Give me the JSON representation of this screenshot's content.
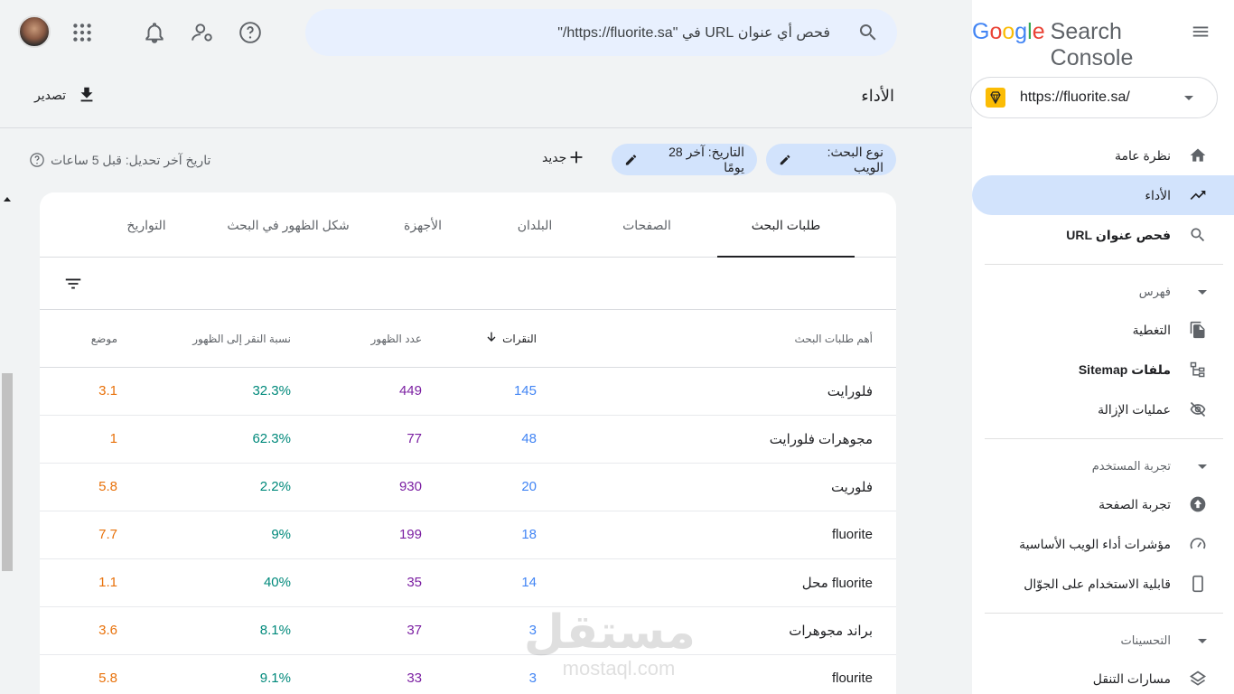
{
  "app": {
    "logo_google": [
      "G",
      "o",
      "o",
      "g",
      "l",
      "e"
    ],
    "logo_rest": "Search Console",
    "property_url": "https://fluorite.sa/"
  },
  "search": {
    "placeholder": "فحص أي عنوان URL في \"https://fluorite.sa/\""
  },
  "sidebar": {
    "items": [
      {
        "label": "نظرة عامة",
        "icon": "home-icon"
      },
      {
        "label": "الأداء",
        "icon": "trending-up-icon",
        "active": true
      },
      {
        "label": "فحص عنوان URL",
        "icon": "search-icon"
      }
    ],
    "sections": [
      {
        "label": "فهرس",
        "items": [
          "التغطية",
          "ملفات Sitemap",
          "عمليات الإزالة"
        ]
      },
      {
        "label": "تجربة المستخدم",
        "items": [
          "تجربة الصفحة",
          "مؤشرات أداء الويب الأساسية",
          "قابلية الاستخدام على الجوّال"
        ]
      },
      {
        "label": "التحسينات",
        "items": [
          "مسارات التنقل"
        ]
      }
    ]
  },
  "header": {
    "title": "الأداء",
    "export_label": "تصدير"
  },
  "filters": {
    "search_type": "نوع البحث: الويب",
    "date": "التاريخ: آخر 28 يومًا",
    "new_label": "جديد",
    "last_update": "تاريخ آخر تحديل: قبل 5 ساعات"
  },
  "tabs": [
    "طلبات البحث",
    "الصفحات",
    "البلدان",
    "الأجهزة",
    "شكل الظهور في البحث",
    "التواريخ"
  ],
  "table": {
    "headers": {
      "query": "أهم طلبات البحث",
      "clicks": "النقرات",
      "impressions": "عدد الظهور",
      "ctr": "نسبة النقر إلى الظهور",
      "position": "موضع"
    },
    "rows": [
      {
        "query": "فلورايت",
        "clicks": "145",
        "impressions": "449",
        "ctr": "32.3%",
        "position": "3.1"
      },
      {
        "query": "مجوهرات فلورايت",
        "clicks": "48",
        "impressions": "77",
        "ctr": "62.3%",
        "position": "1"
      },
      {
        "query": "فلوريت",
        "clicks": "20",
        "impressions": "930",
        "ctr": "2.2%",
        "position": "5.8"
      },
      {
        "query": "fluorite",
        "clicks": "18",
        "impressions": "199",
        "ctr": "9%",
        "position": "7.7"
      },
      {
        "query": "fluorite محل",
        "clicks": "14",
        "impressions": "35",
        "ctr": "40%",
        "position": "1.1"
      },
      {
        "query": "براند مجوهرات",
        "clicks": "3",
        "impressions": "37",
        "ctr": "8.1%",
        "position": "3.6"
      },
      {
        "query": "flourite",
        "clicks": "3",
        "impressions": "33",
        "ctr": "9.1%",
        "position": "5.8"
      }
    ]
  },
  "watermark": {
    "arabic": "مستقل",
    "latin": "mostaql.com"
  },
  "colors": {
    "accent": "#d2e3fc",
    "clicks": "#4285f4",
    "impressions": "#7b1fa2",
    "ctr": "#00897b",
    "position": "#e8710a"
  }
}
